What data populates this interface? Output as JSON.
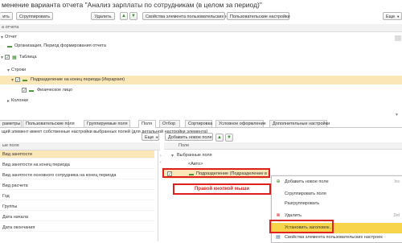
{
  "window": {
    "title": "менение варианта отчета \"Анализ зарплаты по сотрудникам (в целом за период)\""
  },
  "toolbar": {
    "add_label": "ить",
    "group_label": "Сгруппировать",
    "delete_label": "Удалить",
    "element_props_label": "Свойства элемента пользовательских настроек",
    "user_settings_label": "Пользовательские настройки",
    "more_label": "Еще"
  },
  "structure": {
    "header": "а отчета",
    "rows": [
      {
        "label": "Отчет"
      },
      {
        "label": "Организация, Период формирования отчета"
      },
      {
        "label": "Таблица"
      },
      {
        "label": "Строки"
      },
      {
        "label": "Подразделение на конец периода (Иерархия)"
      },
      {
        "label": "Физическое лицо"
      },
      {
        "label": "Колонки"
      }
    ]
  },
  "tabs": [
    {
      "label": "раметры"
    },
    {
      "label": "Пользовательские поля"
    },
    {
      "label": "Группируемые поля"
    },
    {
      "label": "Поля"
    },
    {
      "label": "Отбор"
    },
    {
      "label": "Сортировка"
    },
    {
      "label": "Условное оформление"
    },
    {
      "label": "Дополнительные настройки"
    }
  ],
  "hint": "щий элемент имеет собственные настройки выбранных полей (для детальной настройки элемента)",
  "available_fields": {
    "more_label": "Еще",
    "column_header": "ые поля",
    "items": [
      "Вид занятости",
      "Вид занятости на конец периода",
      "Вид занятости основного сотрудника на конец периода",
      "Вид расчета",
      "Год",
      "Группы",
      "Дата начала",
      "Дата окончания"
    ]
  },
  "selected_fields": {
    "add_new_label": "Добавить новое поле",
    "column_header": "Поле",
    "items": [
      {
        "label": "Выбранные поля"
      },
      {
        "label": "<Авто>"
      },
      {
        "label": "Подразделение (Подразделение в целом за период)"
      }
    ]
  },
  "annotation": "Правой кнопкой мыши",
  "context_menu": {
    "items": [
      {
        "label": "Добавить новое поле",
        "shortcut": "Ins",
        "icon": "add-icon"
      },
      {
        "label": "Сгруппировать поля",
        "shortcut": "",
        "icon": ""
      },
      {
        "label": "Разгруппировать",
        "shortcut": "",
        "icon": ""
      },
      {
        "label": "Удалить",
        "shortcut": "Del",
        "icon": "delete-icon"
      },
      {
        "label": "Установить заголовок...",
        "shortcut": "",
        "icon": ""
      },
      {
        "label": "Свойства элемента пользовательских настроек",
        "shortcut": "",
        "icon": "properties-icon"
      }
    ]
  },
  "colors": {
    "highlight": "#fbe6b8",
    "annotation_red": "#e0201b",
    "menu_highlight": "#f7d44a",
    "accent_green": "#3c8d2f"
  }
}
